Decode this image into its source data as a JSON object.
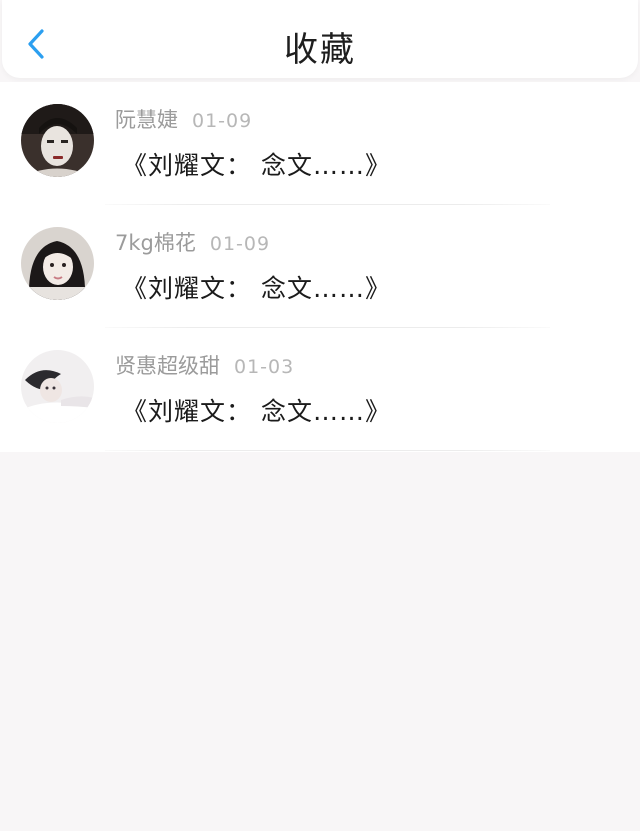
{
  "header": {
    "title": "收藏",
    "back_icon": "chevron-left-icon",
    "accent_color": "#2b9ff0"
  },
  "favorites": [
    {
      "name": "阮慧婕",
      "date": "01-09",
      "quote": "《刘耀文： 念文……》",
      "avatar_icon": "user-avatar-1"
    },
    {
      "name": "7kg棉花",
      "date": "01-09",
      "quote": "《刘耀文： 念文……》",
      "avatar_icon": "user-avatar-2"
    },
    {
      "name": "贤惠超级甜",
      "date": "01-03",
      "quote": "《刘耀文： 念文……》",
      "avatar_icon": "user-avatar-3"
    }
  ]
}
